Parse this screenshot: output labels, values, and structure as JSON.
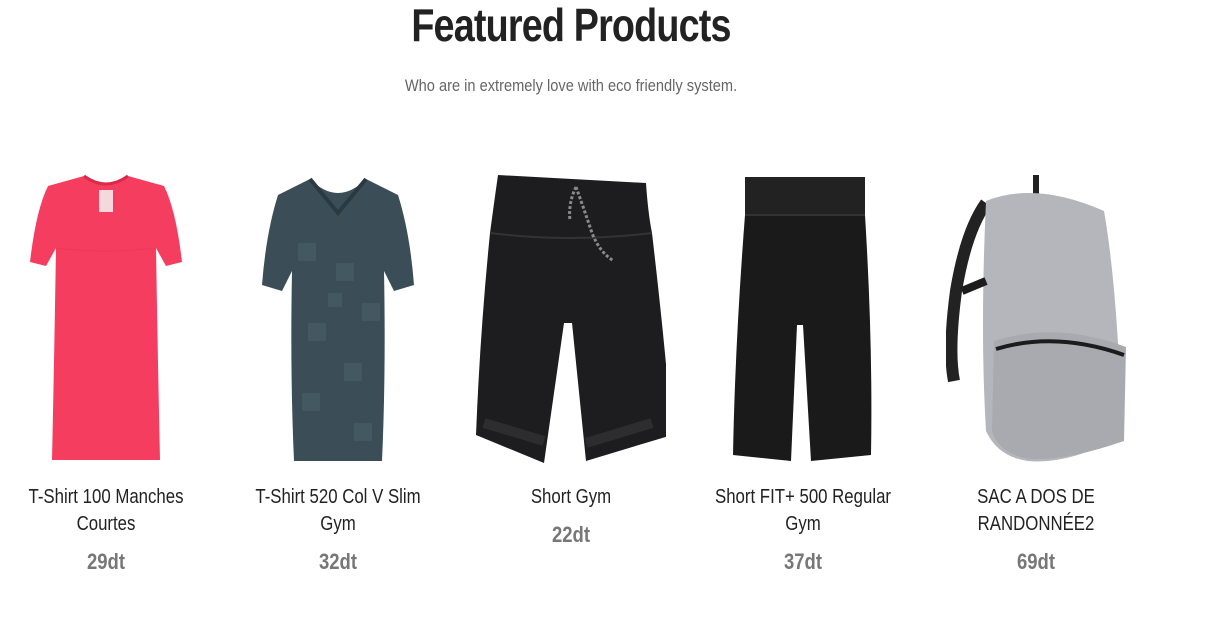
{
  "section": {
    "title": "Featured Products",
    "subtitle": "Who are in extremely love with eco friendly system."
  },
  "products": [
    {
      "name_line1": "T-Shirt 100 Manches",
      "name_line2": "Courtes",
      "price": "29dt",
      "image": "pink-tshirt-image",
      "color": "#f53d5f"
    },
    {
      "name": "T-Shirt 520 Col V Slim Gym",
      "price": "32dt",
      "image": "dark-teal-tshirt-image",
      "color": "#3b4e57"
    },
    {
      "name": "Short Gym",
      "price": "22dt",
      "image": "black-shorts-image",
      "color": "#1d1d1f"
    },
    {
      "name": "Short FIT+ 500 Regular Gym",
      "price": "37dt",
      "image": "black-long-shorts-image",
      "color": "#1a1a1a"
    },
    {
      "name_line1": "SAC A DOS DE",
      "name_line2": "RANDONNÉE2",
      "price": "69dt",
      "image": "grey-backpack-image",
      "color": "#b4b6bb"
    }
  ]
}
